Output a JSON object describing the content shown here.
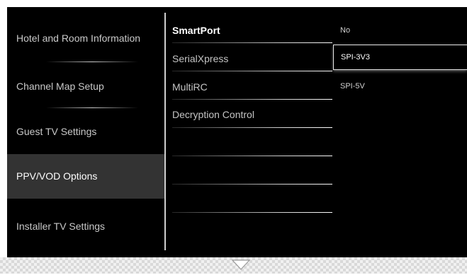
{
  "left_menu": {
    "items": [
      {
        "label": "Hotel and Room Information",
        "active": false
      },
      {
        "label": "Channel Map Setup",
        "active": false
      },
      {
        "label": "Guest TV Settings",
        "active": false
      },
      {
        "label": "PPV/VOD Options",
        "active": true
      },
      {
        "label": "Installer TV Settings",
        "active": false
      }
    ]
  },
  "middle_menu": {
    "items": [
      {
        "label": "SmartPort",
        "focused": true
      },
      {
        "label": "SerialXpress",
        "focused": false
      },
      {
        "label": "MultiRC",
        "focused": false
      },
      {
        "label": "Decryption Control",
        "focused": false
      }
    ]
  },
  "options": {
    "items": [
      {
        "label": "No",
        "highlighted": false
      },
      {
        "label": "SPI-3V3",
        "highlighted": true
      },
      {
        "label": "SPI-5V",
        "highlighted": false
      }
    ]
  },
  "icons": {
    "scroll_down": "chevron-down-icon"
  },
  "colors": {
    "background": "#000000",
    "active_item": "#333333",
    "text": "#c9c9c9",
    "text_active": "#ffffff"
  }
}
